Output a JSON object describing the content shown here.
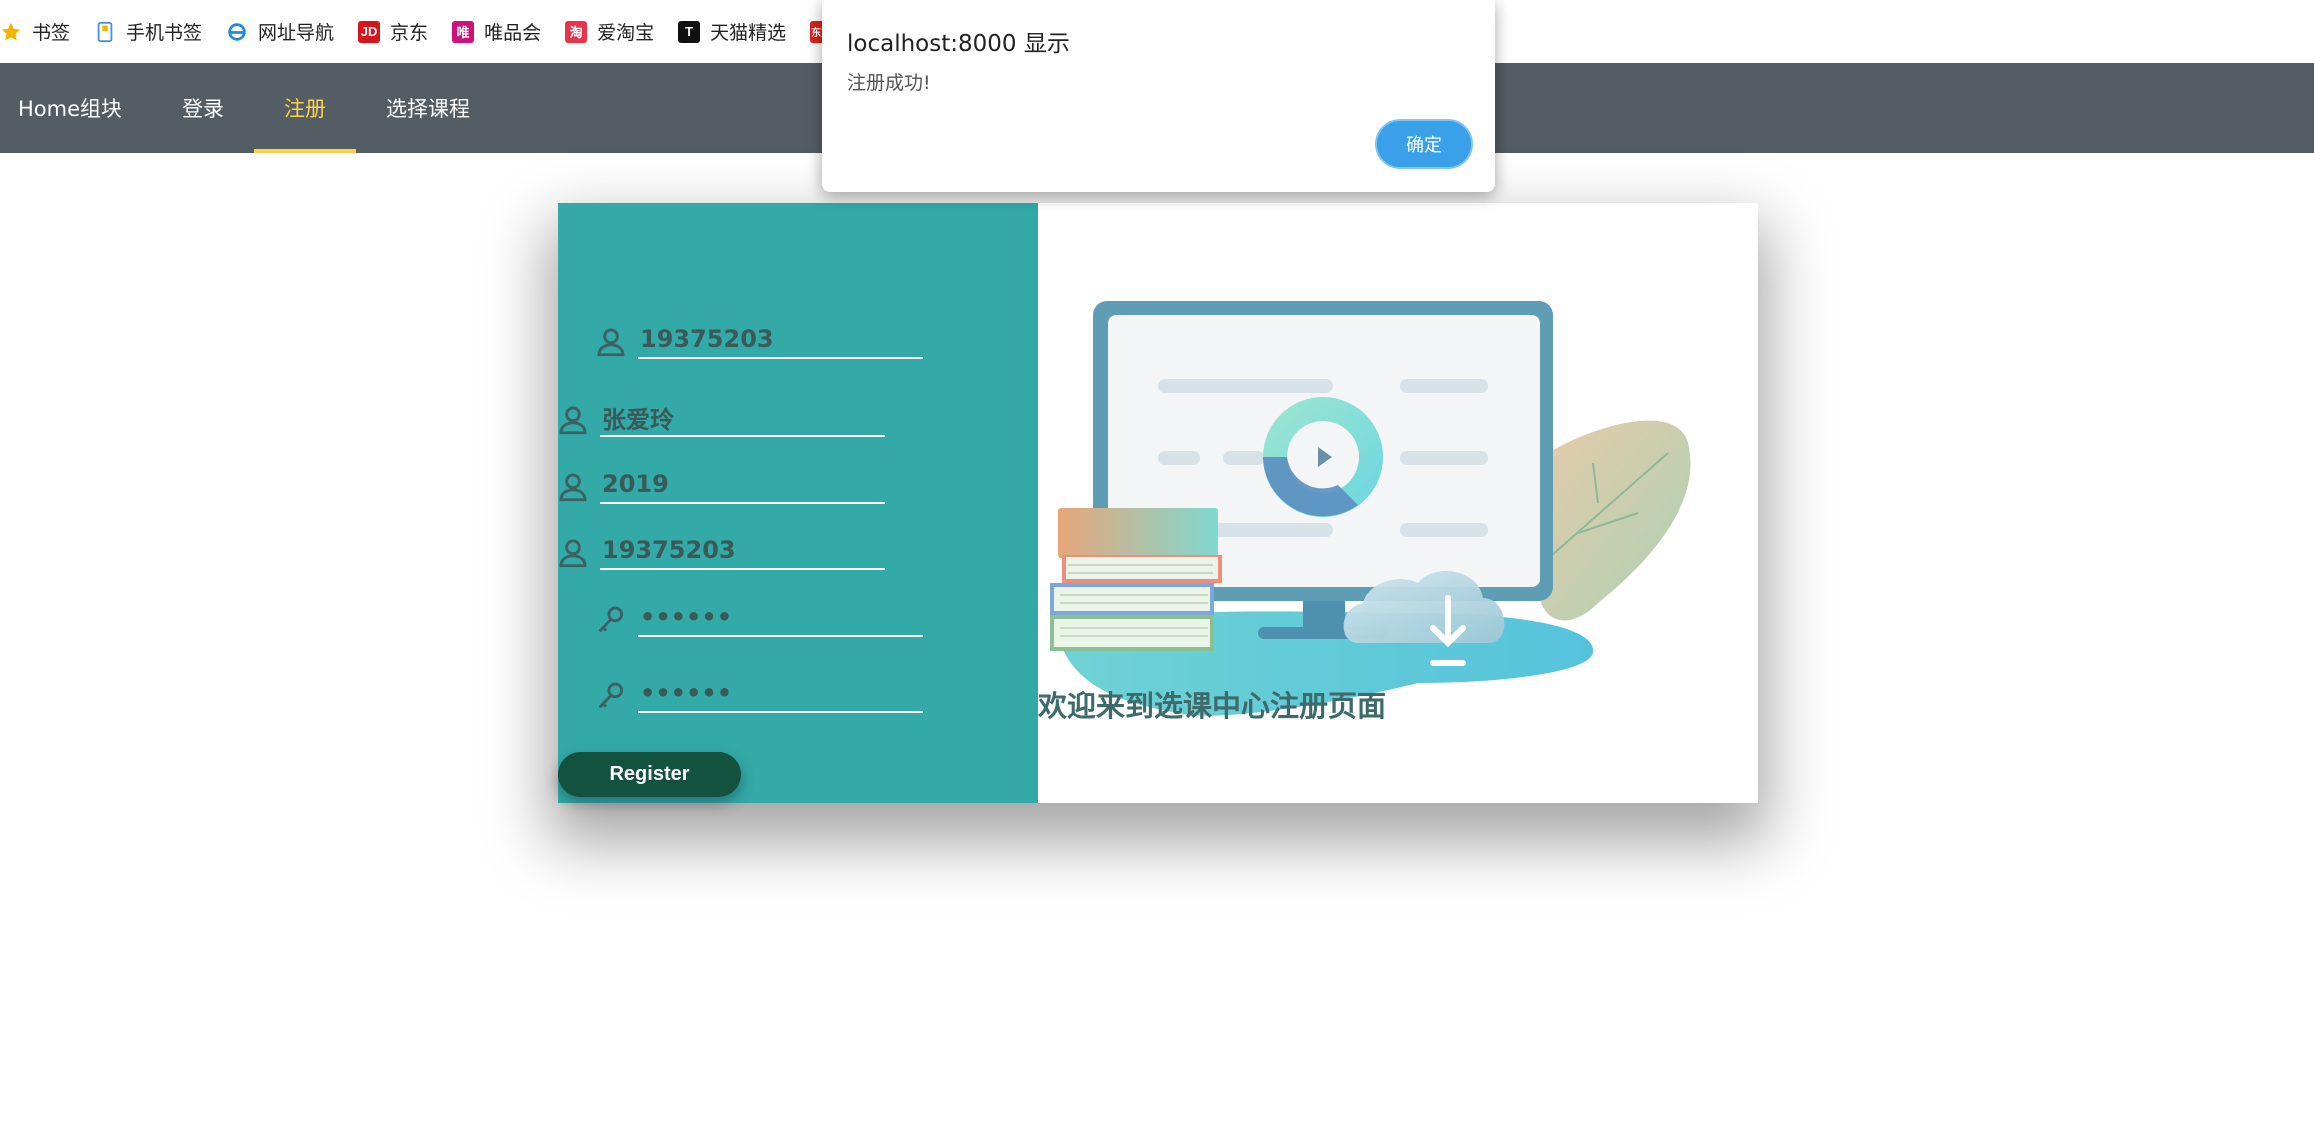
{
  "bookmarks": [
    {
      "label": "书签",
      "icon": "star-icon",
      "color": "#f5b400"
    },
    {
      "label": "手机书签",
      "icon": "phone-icon",
      "color": "#4a90e2"
    },
    {
      "label": "网址导航",
      "icon": "ie-icon",
      "color": "#1e88e5"
    },
    {
      "label": "京东",
      "icon": "jd-icon",
      "color": "#d7141a"
    },
    {
      "label": "唯品会",
      "icon": "vip-icon",
      "color": "#d0107a"
    },
    {
      "label": "爱淘宝",
      "icon": "taobao-icon",
      "color": "#e8334a"
    },
    {
      "label": "天猫精选",
      "icon": "tmall-icon",
      "color": "#111111"
    },
    {
      "label": "",
      "icon": "dongfang-icon",
      "color": "#e0201a"
    }
  ],
  "nav": {
    "items": [
      {
        "label": "Home组块",
        "active": false
      },
      {
        "label": "登录",
        "active": false
      },
      {
        "label": "注册",
        "active": true
      },
      {
        "label": "选择课程",
        "active": false
      }
    ],
    "active_color": "#ffd04b",
    "bg_color": "#545c64"
  },
  "form": {
    "student_id": "19375203",
    "name": "张爱玲",
    "grade": "2019",
    "student_id_2": "19375203",
    "password": "••••••",
    "password_confirm": "••••••",
    "register_label": "Register"
  },
  "welcome_text": "欢迎来到选课中心注册页面",
  "dialog": {
    "title": "localhost:8000 显示",
    "message": "注册成功!",
    "ok_label": "确定"
  },
  "colors": {
    "left_panel": "#33a9a8",
    "register_button": "#145240",
    "dialog_button": "#3aa0ea"
  }
}
